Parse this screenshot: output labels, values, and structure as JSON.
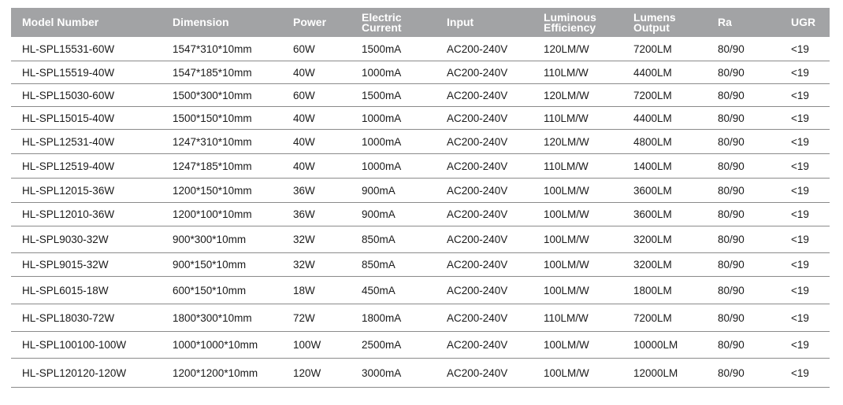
{
  "table": {
    "headers": [
      [
        "Model Number"
      ],
      [
        "Dimension"
      ],
      [
        "Power"
      ],
      [
        "Electric",
        "Current"
      ],
      [
        "Input"
      ],
      [
        "Luminous",
        "Efficiency"
      ],
      [
        "Lumens",
        "Output"
      ],
      [
        "Ra"
      ],
      [
        "UGR"
      ]
    ],
    "rows": [
      [
        "HL-SPL15531-60W",
        "1547*310*10mm",
        "60W",
        "1500mA",
        "AC200-240V",
        "120LM/W",
        "7200LM",
        "80/90",
        "<19"
      ],
      [
        "HL-SPL15519-40W",
        "1547*185*10mm",
        "40W",
        "1000mA",
        "AC200-240V",
        "110LM/W",
        "4400LM",
        "80/90",
        "<19"
      ],
      [
        "HL-SPL15030-60W",
        "1500*300*10mm",
        "60W",
        "1500mA",
        "AC200-240V",
        "120LM/W",
        "7200LM",
        "80/90",
        "<19"
      ],
      [
        "HL-SPL15015-40W",
        "1500*150*10mm",
        "40W",
        "1000mA",
        "AC200-240V",
        "110LM/W",
        "4400LM",
        "80/90",
        "<19"
      ],
      [
        "HL-SPL12531-40W",
        "1247*310*10mm",
        "40W",
        "1000mA",
        "AC200-240V",
        "120LM/W",
        "4800LM",
        "80/90",
        "<19"
      ],
      [
        "HL-SPL12519-40W",
        "1247*185*10mm",
        "40W",
        "1000mA",
        "AC200-240V",
        "110LM/W",
        "1400LM",
        "80/90",
        "<19"
      ],
      [
        "HL-SPL12015-36W",
        "1200*150*10mm",
        "36W",
        "900mA",
        "AC200-240V",
        "100LM/W",
        "3600LM",
        "80/90",
        "<19"
      ],
      [
        "HL-SPL12010-36W",
        "1200*100*10mm",
        "36W",
        "900mA",
        "AC200-240V",
        "100LM/W",
        "3600LM",
        "80/90",
        "<19"
      ],
      [
        "HL-SPL9030-32W",
        "900*300*10mm",
        "32W",
        "850mA",
        "AC200-240V",
        "100LM/W",
        "3200LM",
        "80/90",
        "<19"
      ],
      [
        "HL-SPL9015-32W",
        "900*150*10mm",
        "32W",
        "850mA",
        "AC200-240V",
        "100LM/W",
        "3200LM",
        "80/90",
        "<19"
      ],
      [
        "HL-SPL6015-18W",
        "600*150*10mm",
        "18W",
        "450mA",
        "AC200-240V",
        "100LM/W",
        "1800LM",
        "80/90",
        "<19"
      ],
      [
        "HL-SPL18030-72W",
        "1800*300*10mm",
        "72W",
        "1800mA",
        "AC200-240V",
        "110LM/W",
        "7200LM",
        "80/90",
        "<19"
      ],
      [
        "HL-SPL100100-100W",
        "1000*1000*10mm",
        "100W",
        "2500mA",
        "AC200-240V",
        "100LM/W",
        "10000LM",
        "80/90",
        "<19"
      ],
      [
        "HL-SPL120120-120W",
        "1200*1200*10mm",
        "120W",
        "3000mA",
        "AC200-240V",
        "100LM/W",
        "12000LM",
        "80/90",
        "<19"
      ]
    ]
  },
  "colors": {
    "header_bg": "#a2a3a5",
    "header_text": "#ffffff",
    "row_text": "#1a1a1a",
    "row_divider": "#8a8a8a"
  }
}
